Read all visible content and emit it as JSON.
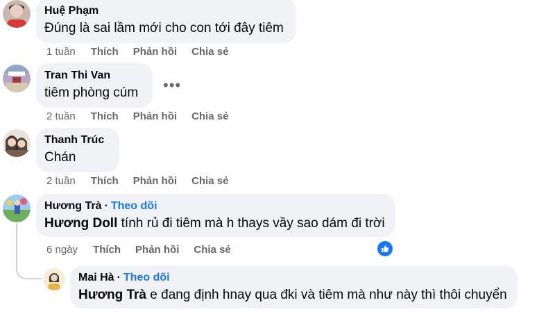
{
  "actions": {
    "like": "Thích",
    "reply": "Phản hồi",
    "share": "Chia sẻ"
  },
  "comments": [
    {
      "author": "Huệ Phạm",
      "text": "Đúng là sai lầm mới cho con tới đây tiêm",
      "time": "1 tuần"
    },
    {
      "author": "Tran Thi Van",
      "text": "tiêm phòng cúm",
      "time": "2 tuần"
    },
    {
      "author": "Thanh Trúc",
      "text": "Chán",
      "time": "2 tuần"
    },
    {
      "author": "Hương Trà",
      "follow": "Theo dõi",
      "mention": "Hương Doll",
      "text": "tính rủ đi tiêm mà h thays vầy sao dám đi trời",
      "time": "6 ngày"
    },
    {
      "author": "Mai Hà",
      "follow": "Theo dõi",
      "mention": "Hương Trà",
      "text": "e đang định hnay qua đki và tiêm mà như này thì thôi chuyển"
    }
  ],
  "colors": {
    "bubble": "#f0f2f5",
    "link": "#1877f2",
    "meta": "#65676b"
  }
}
